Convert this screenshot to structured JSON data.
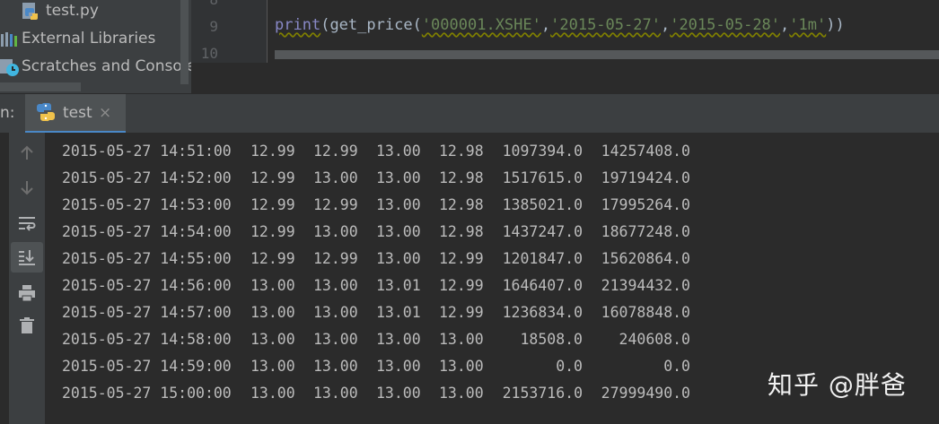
{
  "project_tree": {
    "items": [
      {
        "label": "test.py",
        "icon": "python-file-icon"
      },
      {
        "label": "External Libraries",
        "icon": "libraries-icon"
      },
      {
        "label": "Scratches and Consoles",
        "icon": "scratches-icon"
      }
    ]
  },
  "editor": {
    "line_numbers": [
      "8",
      "9",
      "10"
    ],
    "code": {
      "func": "print",
      "open1": "(",
      "call": "get_price",
      "open2": "(",
      "arg1": "'000001.XSHE'",
      "comma1": ",",
      "arg2": "'2015-05-27'",
      "comma2": ",",
      "arg3": "'2015-05-28'",
      "comma3": ",",
      "arg4": "'1m'",
      "close": "))"
    }
  },
  "run_panel": {
    "label": "n:",
    "tab": {
      "name": "test",
      "close": "×",
      "icon": "python-icon"
    },
    "tools": [
      "up-arrow-icon",
      "down-arrow-icon",
      "soft-wrap-icon",
      "scroll-to-end-icon",
      "print-icon",
      "trash-icon"
    ]
  },
  "output": {
    "rows": [
      {
        "datetime": "2015-05-27 14:51:00",
        "open": "12.99",
        "high": "12.99",
        "low": "13.00",
        "close": "12.98",
        "volume": "1097394.0",
        "money": "14257408.0"
      },
      {
        "datetime": "2015-05-27 14:52:00",
        "open": "12.99",
        "high": "13.00",
        "low": "13.00",
        "close": "12.98",
        "volume": "1517615.0",
        "money": "19719424.0"
      },
      {
        "datetime": "2015-05-27 14:53:00",
        "open": "12.99",
        "high": "12.99",
        "low": "13.00",
        "close": "12.98",
        "volume": "1385021.0",
        "money": "17995264.0"
      },
      {
        "datetime": "2015-05-27 14:54:00",
        "open": "12.99",
        "high": "13.00",
        "low": "13.00",
        "close": "12.98",
        "volume": "1437247.0",
        "money": "18677248.0"
      },
      {
        "datetime": "2015-05-27 14:55:00",
        "open": "12.99",
        "high": "12.99",
        "low": "13.00",
        "close": "12.99",
        "volume": "1201847.0",
        "money": "15620864.0"
      },
      {
        "datetime": "2015-05-27 14:56:00",
        "open": "13.00",
        "high": "13.00",
        "low": "13.01",
        "close": "12.99",
        "volume": "1646407.0",
        "money": "21394432.0"
      },
      {
        "datetime": "2015-05-27 14:57:00",
        "open": "13.00",
        "high": "13.00",
        "low": "13.01",
        "close": "12.99",
        "volume": "1236834.0",
        "money": "16078848.0"
      },
      {
        "datetime": "2015-05-27 14:58:00",
        "open": "13.00",
        "high": "13.00",
        "low": "13.00",
        "close": "13.00",
        "volume": "18508.0",
        "money": "240608.0"
      },
      {
        "datetime": "2015-05-27 14:59:00",
        "open": "13.00",
        "high": "13.00",
        "low": "13.00",
        "close": "13.00",
        "volume": "0.0",
        "money": "0.0"
      },
      {
        "datetime": "2015-05-27 15:00:00",
        "open": "13.00",
        "high": "13.00",
        "low": "13.00",
        "close": "13.00",
        "volume": "2153716.0",
        "money": "27999490.0"
      }
    ]
  },
  "watermark": "知乎 @胖爸"
}
